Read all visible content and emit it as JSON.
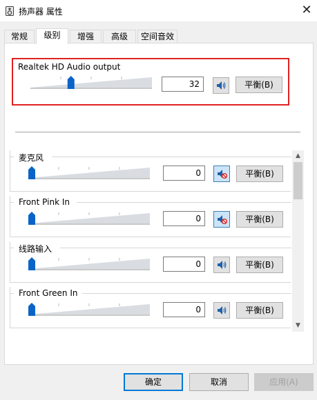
{
  "window": {
    "title": "扬声器 属性",
    "close_glyph": "✕"
  },
  "tabs": [
    {
      "label": "常规",
      "active": false
    },
    {
      "label": "级别",
      "active": true
    },
    {
      "label": "增强",
      "active": false
    },
    {
      "label": "高级",
      "active": false
    },
    {
      "label": "空间音效",
      "active": false
    }
  ],
  "master": {
    "label": "Realtek HD Audio output",
    "volume": "32",
    "level_fraction": 0.32,
    "muted": false,
    "balance_label": "平衡(B)"
  },
  "devices": [
    {
      "label": "麦克风",
      "volume": "0",
      "level_fraction": 0.0,
      "muted": true,
      "balance_label": "平衡(B)"
    },
    {
      "label": "Front Pink In",
      "volume": "0",
      "level_fraction": 0.0,
      "muted": true,
      "balance_label": "平衡(B)"
    },
    {
      "label": "线路输入",
      "volume": "0",
      "level_fraction": 0.0,
      "muted": false,
      "balance_label": "平衡(B)"
    },
    {
      "label": "Front Green In",
      "volume": "0",
      "level_fraction": 0.0,
      "muted": false,
      "balance_label": "平衡(B)"
    }
  ],
  "footer": {
    "ok": "确定",
    "cancel": "取消",
    "apply": "应用(A)"
  },
  "icons": {
    "app": "speaker-properties-icon",
    "speaker": "speaker-icon",
    "muted_speaker": "speaker-muted-icon",
    "scroll_up": "chevron-up-icon",
    "scroll_down": "chevron-down-icon"
  },
  "colors": {
    "highlight": "#e02020",
    "accent": "#0078d7",
    "slider_thumb": "#0a64c8"
  }
}
